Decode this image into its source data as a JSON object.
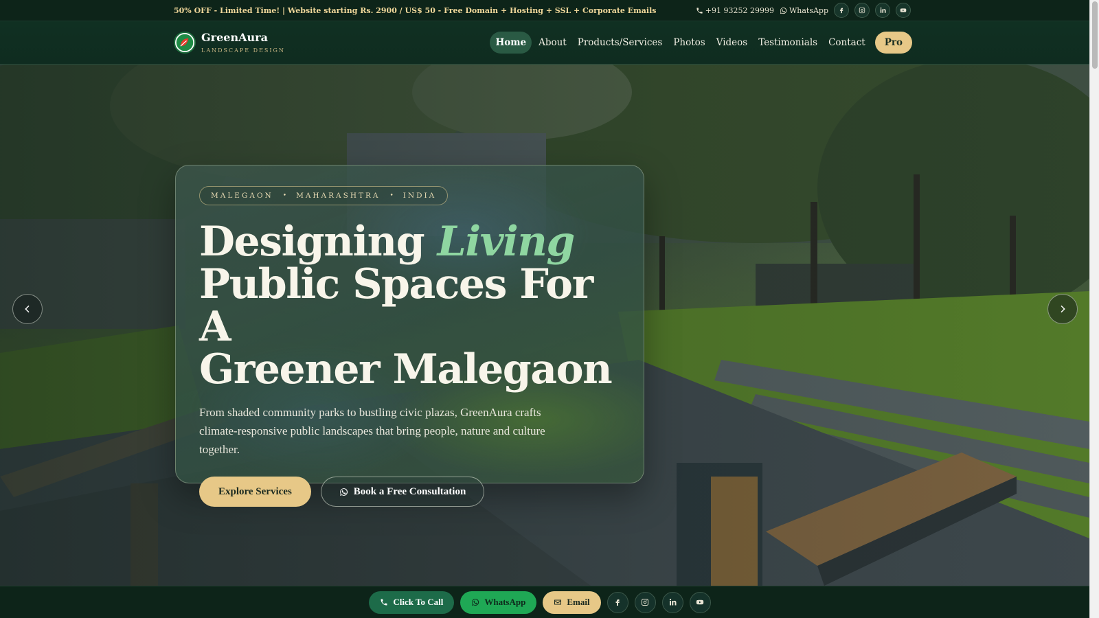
{
  "topbar": {
    "promo": "50% OFF - Limited Time! | Website starting Rs. 2900 / US$ 50 - Free Domain + Hosting + SSL + Corporate Emails",
    "phone": "+91 93252 29999",
    "whatsapp": "WhatsApp",
    "social": [
      "facebook-icon",
      "instagram-icon",
      "linkedin-icon",
      "youtube-icon"
    ]
  },
  "brand": {
    "name": "GreenAura",
    "tagline": "LANDSCAPE DESIGN"
  },
  "nav": {
    "items": [
      "Home",
      "About",
      "Products/Services",
      "Photos",
      "Videos",
      "Testimonials",
      "Contact"
    ],
    "active": "Home",
    "pro_label": "Pro"
  },
  "hero": {
    "location": [
      "MALEGAON",
      "MAHARASHTRA",
      "INDIA"
    ],
    "headline_part1": "Designing",
    "headline_accent": "Living",
    "headline_line2": "Public Spaces For A",
    "headline_line3": "Greener Malegaon",
    "subtext": "From shaded community parks to bustling civic plazas, GreenAura crafts climate-responsive public landscapes that bring people, nature and culture together.",
    "cta_primary": "Explore Services",
    "cta_secondary": "Book a Free Consultation"
  },
  "bottombar": {
    "call": "Click To Call",
    "whatsapp": "WhatsApp",
    "email": "Email",
    "social": [
      "facebook-icon",
      "instagram-icon",
      "linkedin-icon",
      "youtube-icon"
    ]
  },
  "colors": {
    "accent_gold": "#e7c887",
    "accent_green": "#8fd6a1",
    "dark_green": "#0d2419",
    "whatsapp_green": "#1fa855"
  }
}
